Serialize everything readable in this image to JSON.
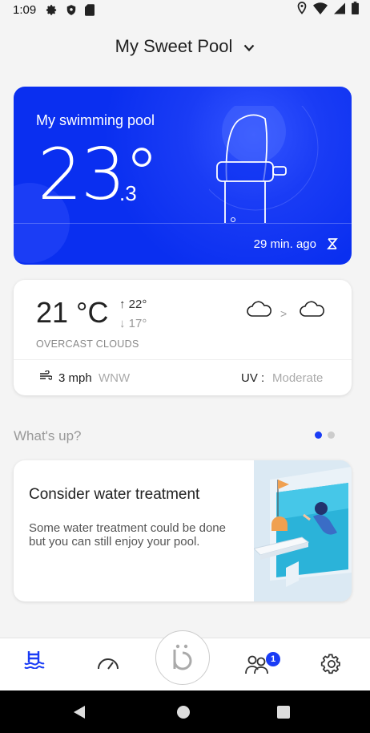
{
  "status_bar": {
    "time": "1:09",
    "left_icons": [
      "gear-icon",
      "shield-icon",
      "sd-card-icon"
    ],
    "right_icons": [
      "location-icon",
      "wifi-icon",
      "signal-icon",
      "battery-icon"
    ]
  },
  "header": {
    "pool_name": "My Sweet Pool",
    "dropdown_icon": "chevron-down-icon"
  },
  "pool_card": {
    "name": "My swimming pool",
    "temp_main": "23°",
    "temp_decimal": ".3",
    "last_update": "29 min. ago",
    "sync_icon": "sync-icon",
    "colors": {
      "background": "#0a2ff0"
    }
  },
  "weather": {
    "temperature": "21 °C",
    "high": "↑ 22°",
    "low": "↓ 17°",
    "description": "OVERCAST CLOUDS",
    "now_icon": "cloud-icon",
    "later_icon": "cloud-icon",
    "arrow": ">",
    "wind_speed": "3 mph",
    "wind_dir": "WNW",
    "uv_label": "UV :",
    "uv_value": "Moderate"
  },
  "whats_up": {
    "title": "What's up?",
    "page_count": 2,
    "active_page": 0
  },
  "treatment_card": {
    "title": "Consider water treatment",
    "body": "Some water treatment could be done but you can still enjoy your pool."
  },
  "bottom_nav": {
    "items": [
      {
        "icon": "pool-icon",
        "active": true
      },
      {
        "icon": "gauge-icon",
        "active": false
      },
      {
        "icon": "brand-logo-icon",
        "label": "b̈"
      },
      {
        "icon": "community-icon",
        "badge": "1"
      },
      {
        "icon": "gear-icon",
        "active": false
      }
    ],
    "colors": {
      "active": "#1a3cf5",
      "inactive": "#333"
    }
  },
  "android_nav": [
    "back-icon",
    "home-icon",
    "recents-icon"
  ]
}
